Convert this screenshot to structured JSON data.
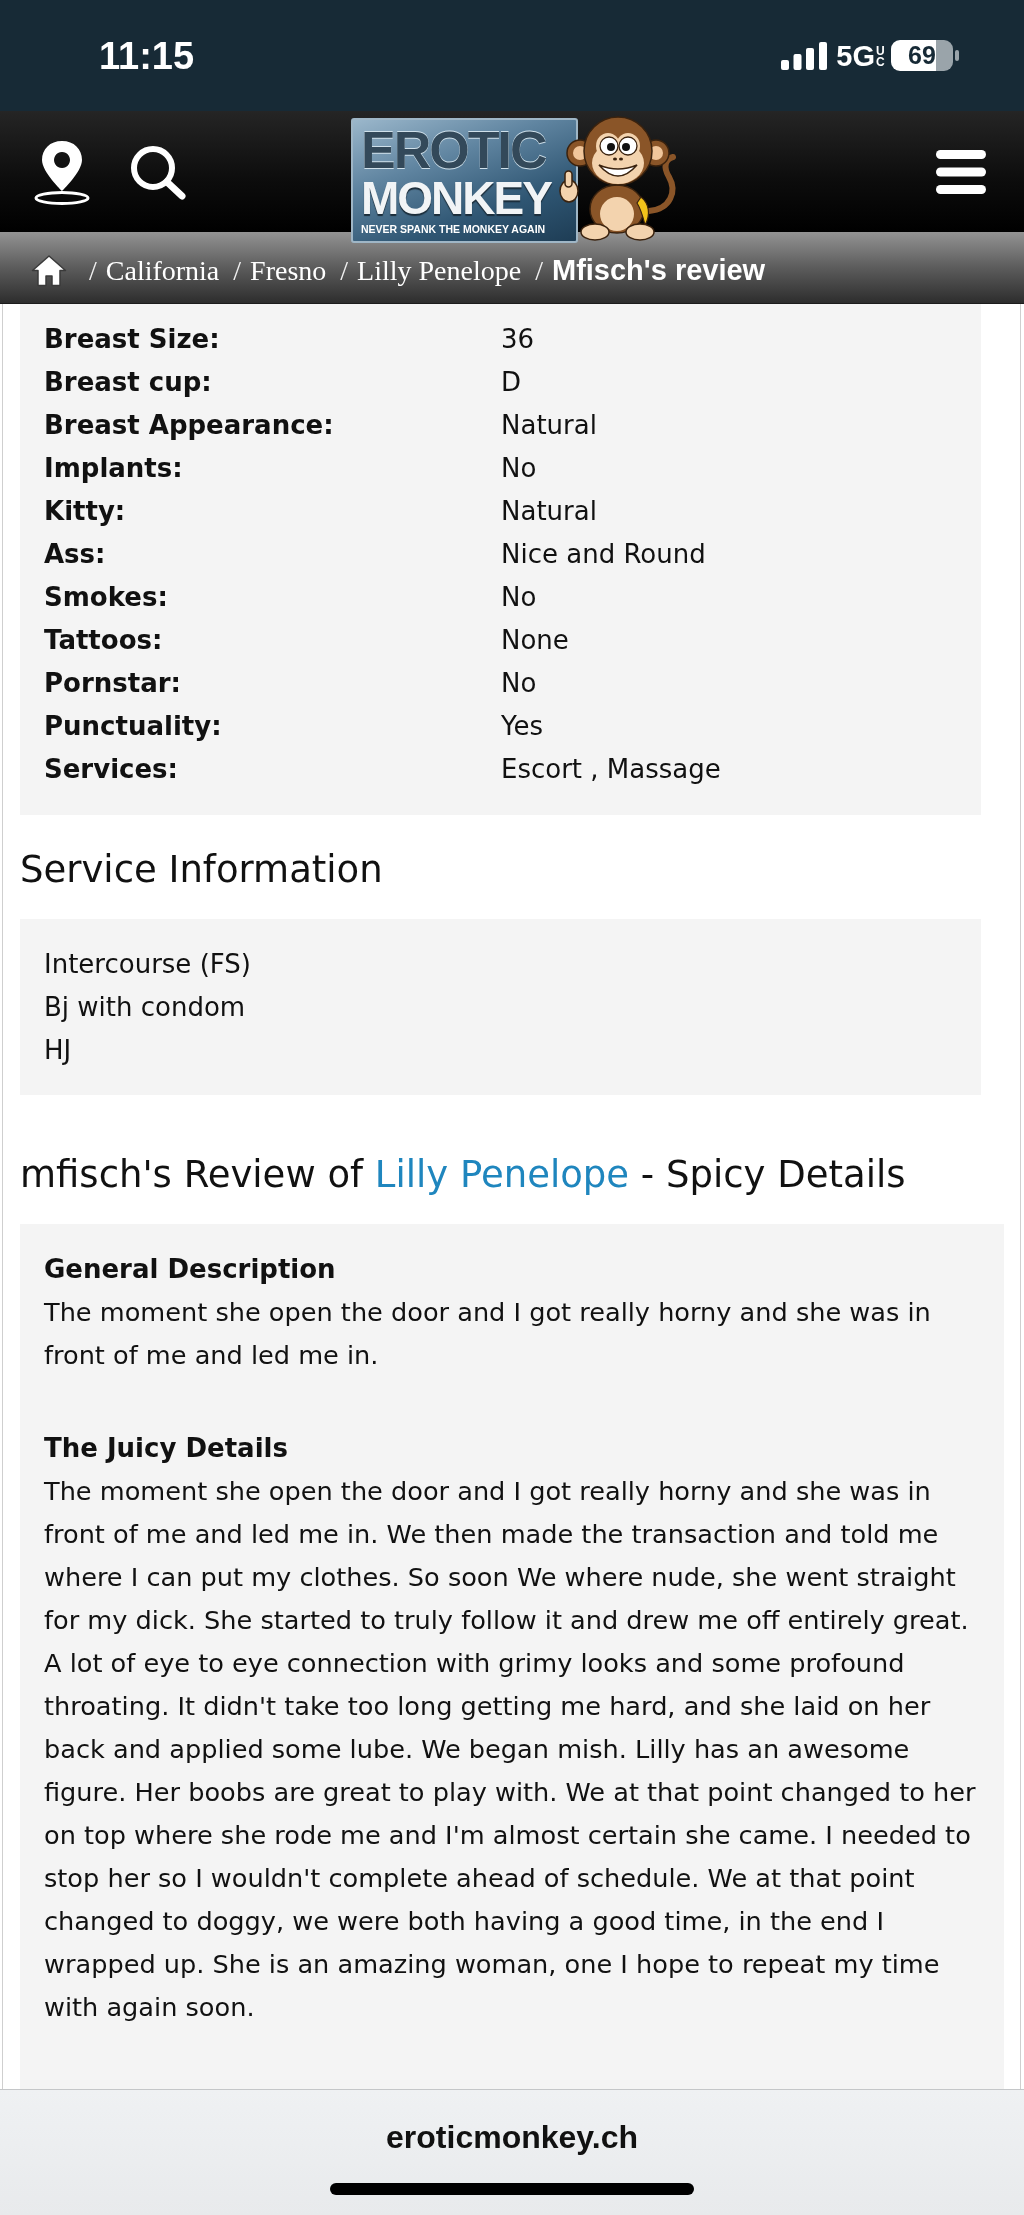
{
  "status_bar": {
    "time": "11:15",
    "network": "5G",
    "network_suffix": "UC",
    "battery": "69"
  },
  "header": {
    "logo": {
      "line_1": "EROTIC",
      "line_2": "MONKEY",
      "tagline": "NEVER SPANK THE MONKEY AGAIN"
    }
  },
  "breadcrumb": {
    "items": [
      {
        "separator": "/",
        "label": "California",
        "current": false
      },
      {
        "separator": "/",
        "label": "Fresno",
        "current": false
      },
      {
        "separator": "/",
        "label": "Lilly Penelope",
        "current": false
      },
      {
        "separator": "/",
        "label": "Mfisch's review",
        "current": true
      }
    ]
  },
  "profile_details": {
    "rows": [
      {
        "label": "Breast Size:",
        "value": "36"
      },
      {
        "label": "Breast cup:",
        "value": "D"
      },
      {
        "label": "Breast Appearance:",
        "value": "Natural"
      },
      {
        "label": "Implants:",
        "value": "No"
      },
      {
        "label": "Kitty:",
        "value": "Natural"
      },
      {
        "label": "Ass:",
        "value": "Nice and Round"
      },
      {
        "label": "Smokes:",
        "value": "No"
      },
      {
        "label": "Tattoos:",
        "value": "None"
      },
      {
        "label": "Pornstar:",
        "value": "No"
      },
      {
        "label": "Punctuality:",
        "value": "Yes"
      },
      {
        "label": "Services:",
        "value": "Escort , Massage"
      }
    ]
  },
  "service_information": {
    "title": "Service Information",
    "items": [
      "Intercourse (FS)",
      "Bj with condom",
      "HJ"
    ]
  },
  "review": {
    "title": {
      "before": "mfisch's Review of ",
      "link": "Lilly Penelope",
      "after": " - Spicy Details"
    },
    "sections": [
      {
        "heading": "General Description",
        "text": "The moment she open the door and I got really horny and she was in front of me and led me in."
      },
      {
        "heading": "The Juicy Details",
        "text": "The moment she open the door and I got really horny and she was in front of me and led me in. We then made the transaction and told me where I can put my clothes. So soon We where nude, she went straight for my dick. She started to truly follow it and drew me off entirely great. A lot of eye to eye connection with grimy looks and some profound throating. It didn't take too long getting me hard, and she laid on her back and applied some lube. We began mish. Lilly has an awesome figure. Her boobs are great to play with. We at that point changed to her on top where she rode me and I'm almost certain she came. I needed to stop her so I wouldn't complete ahead of schedule. We at that point changed to doggy, we were both having a good time, in the end I wrapped up. She is an amazing woman, one I hope to repeat my time with again soon."
      }
    ]
  },
  "browser_bar": {
    "url": "eroticmonkey.ch"
  }
}
